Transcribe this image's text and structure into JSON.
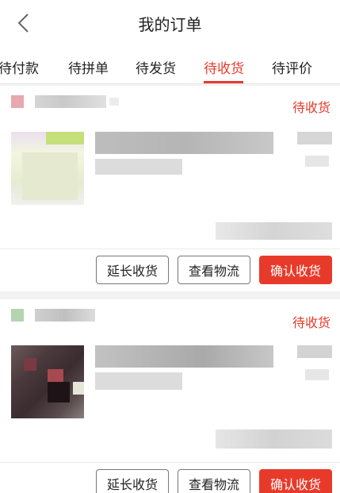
{
  "header": {
    "title": "我的订单",
    "back_icon": "chevron-left-icon"
  },
  "tabs": [
    {
      "label": "待付款",
      "active": false
    },
    {
      "label": "待拼单",
      "active": false
    },
    {
      "label": "待发货",
      "active": false
    },
    {
      "label": "待收货",
      "active": true
    },
    {
      "label": "待评价",
      "active": false
    }
  ],
  "colors": {
    "accent": "#e83a2a"
  },
  "orders": [
    {
      "status": "待收货",
      "buttons": {
        "extend": "延长收货",
        "logistics": "查看物流",
        "confirm": "确认收货"
      }
    },
    {
      "status": "待收货",
      "buttons": {
        "extend": "延长收货",
        "logistics": "查看物流",
        "confirm": "确认收货"
      }
    }
  ]
}
